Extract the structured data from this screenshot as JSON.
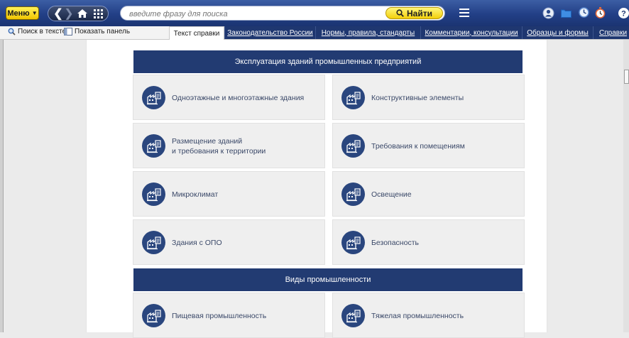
{
  "toolbar": {
    "menu_label": "Меню",
    "search_placeholder": "введите фразу для поиска",
    "search_button": "Найти"
  },
  "subtoolbar": {
    "search_in_text": "Поиск в тексте",
    "show_panel": "Показать панель",
    "tabs": [
      "Текст справки",
      "Законодательство России",
      "Нормы, правила, стандарты",
      "Комментарии, консультации",
      "Образцы и формы",
      "Справки"
    ]
  },
  "content": {
    "sections": [
      {
        "title": "Эксплуатация зданий промышленных предприятий",
        "items": [
          [
            "Одноэтажные и многоэтажные здания"
          ],
          [
            "Конструктивные элементы"
          ],
          [
            "Размещение зданий",
            "и требования к территории"
          ],
          [
            "Требования к помещениям"
          ],
          [
            "Микроклимат"
          ],
          [
            "Освещение"
          ],
          [
            "Здания с ОПО"
          ],
          [
            "Безопасность"
          ]
        ]
      },
      {
        "title": "Виды промышленности",
        "items": [
          [
            "Пищевая промышленность"
          ],
          [
            "Тяжелая промышленность"
          ]
        ]
      }
    ]
  },
  "colors": {
    "header_blue": "#223b72",
    "badge_blue": "#2a467e",
    "menu_yellow": "#f7de1e",
    "card_bg": "#efefef"
  },
  "icons": {
    "card_icon": "building-document-icon",
    "toolbar": [
      "user-icon",
      "folder-icon",
      "clock-icon",
      "stopwatch-icon",
      "help-icon"
    ]
  }
}
